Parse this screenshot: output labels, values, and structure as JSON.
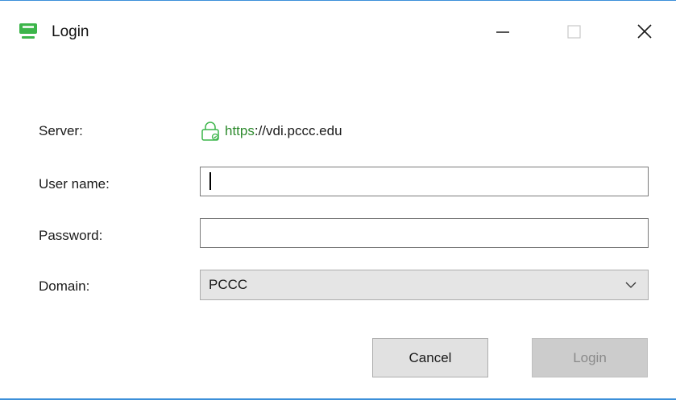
{
  "window": {
    "title": "Login",
    "icon": "monitor-icon",
    "accent_color": "#3c8fd9"
  },
  "titlebar_controls": {
    "minimize": "minimize-icon",
    "maximize": "maximize-icon",
    "close": "close-icon"
  },
  "form": {
    "server_label": "Server:",
    "server_scheme": "https",
    "server_rest": "://vdi.pccc.edu",
    "server_lock_icon": "lock-icon",
    "server_color": "#2d8a2d",
    "username_label": "User name:",
    "username_value": "",
    "password_label": "Password:",
    "password_value": "",
    "domain_label": "Domain:",
    "domain_value": "PCCC"
  },
  "buttons": {
    "cancel": "Cancel",
    "login": "Login",
    "login_enabled": false
  }
}
